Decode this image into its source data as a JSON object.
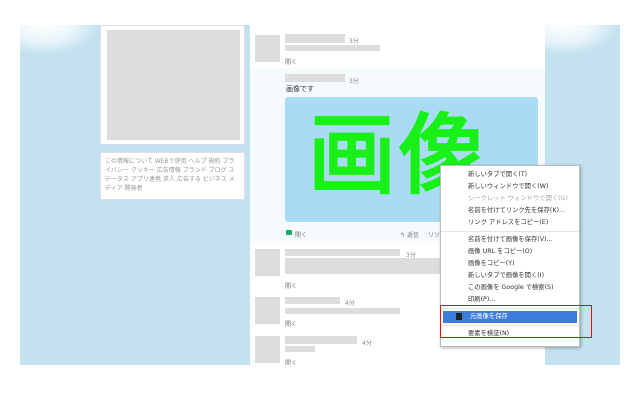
{
  "sidebar": {
    "links": [
      "この情報について",
      "WEBで使用",
      "ヘルプ",
      "規約",
      "プライバシー",
      "クッキー",
      "広告情報",
      "ブランド",
      "ブログ",
      "ステータス",
      "アプリ連携",
      "求人",
      "広告する",
      "ビジネス",
      "メディア",
      "開発者"
    ]
  },
  "tweets": [
    {
      "time": "3分",
      "open": "開く"
    },
    {
      "time": "3分",
      "text": "画像です",
      "image_text": "画像",
      "open": "開く",
      "reply": "返信",
      "retweet": "リツイート"
    },
    {
      "time": "3分",
      "open": "開く"
    },
    {
      "time": "4分",
      "open": "開く"
    },
    {
      "time": "4分",
      "open": "開く"
    }
  ],
  "context_menu": {
    "items": [
      {
        "label": "新しいタブで開く(T)"
      },
      {
        "label": "新しいウィンドウで開く(W)"
      },
      {
        "label": "シークレット ウィンドウで開く(G)",
        "disabled": true
      },
      {
        "label": "名前を付けてリンク先を保存(K)..."
      },
      {
        "label": "リンク アドレスをコピー(E)"
      },
      {
        "label": "名前を付けて画像を保存(V)..."
      },
      {
        "label": "画像 URL をコピー(O)"
      },
      {
        "label": "画像をコピー(Y)"
      },
      {
        "label": "新しいタブで画像を開く(I)"
      },
      {
        "label": "この画像を Google で検索(S)"
      },
      {
        "label": "印刷(P)..."
      },
      {
        "label": "元画像を保存",
        "highlighted": true
      },
      {
        "label": "要素を検証(N)"
      }
    ]
  }
}
